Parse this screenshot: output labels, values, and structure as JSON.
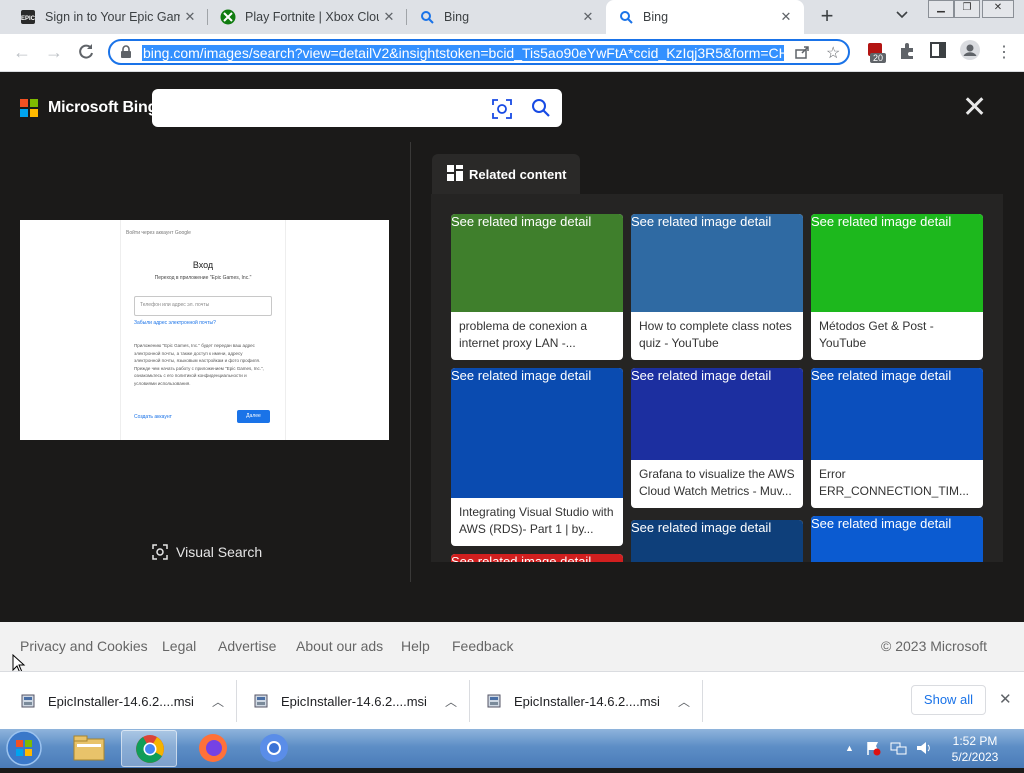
{
  "browser": {
    "tabs": [
      {
        "title": "Sign in to Your Epic Games",
        "icon": "epic-games-icon"
      },
      {
        "title": "Play Fortnite | Xbox Cloud",
        "icon": "xbox-icon"
      },
      {
        "title": "Bing",
        "icon": "search-icon"
      },
      {
        "title": "Bing",
        "icon": "search-icon",
        "active": true
      }
    ],
    "new_tab": "+",
    "url": "bing.com/images/search?view=detailV2&insightstoken=bcid_Tis5ao90eYwFtA*ccid_KzIqj3R5&form=CH",
    "extension_badge": "20"
  },
  "bing": {
    "logo": "Microsoft Bing",
    "search_value": "",
    "visual_search_label": "Visual Search",
    "related_content_label": "Related content",
    "preview": {
      "top_line": "Войти через аккаунт Google",
      "heading": "Вход",
      "subheading": "Переход в приложение \"Epic Games, Inc.\"",
      "input_placeholder": "Телефон или адрес эл. почты",
      "forgot": "Забыли адрес электронной почты?",
      "body": "Приложению \"Epic Games, Inc.\" будет передан ваш адрес электронной почты, а также доступ к имени, адресу электронной почты, языковым настройкам и фото профиля. Прежде чем начать работу с приложением \"Epic Games, Inc.\", ознакомьтесь с его политикой конфиденциальности и условиями использования.",
      "create": "Создать аккаунт",
      "next": "Далее"
    },
    "cards": [
      {
        "alt": "See related image detail",
        "caption": "problema de conexion a internet proxy LAN -...",
        "color": "#3f7f2c"
      },
      {
        "alt": "See related image detail",
        "caption": "How to complete class notes quiz - YouTube",
        "color": "#2f6aa3"
      },
      {
        "alt": "See related image detail",
        "caption": "Métodos Get & Post - YouTube",
        "color": "#1db81d"
      },
      {
        "alt": "See related image detail",
        "caption": "Integrating Visual Studio with AWS (RDS)- Part 1 | by...",
        "color": "#0a4bb0"
      },
      {
        "alt": "See related image detail",
        "caption": "Grafana to visualize the AWS Cloud Watch Metrics - Muv...",
        "color": "#1c2fa0"
      },
      {
        "alt": "See related image detail",
        "caption": "Error ERR_CONNECTION_TIM...",
        "color": "#0b4fbd"
      },
      {
        "alt": "See related image detail",
        "caption": "",
        "color": "#d11f1f"
      },
      {
        "alt": "See related image detail",
        "caption": "",
        "color": "#0e3f7a"
      },
      {
        "alt": "See related image detail",
        "caption": "",
        "color": "#0b5bd1"
      }
    ]
  },
  "footer": {
    "links": [
      "Privacy and Cookies",
      "Legal",
      "Advertise",
      "About our ads",
      "Help",
      "Feedback"
    ],
    "copyright": "© 2023 Microsoft"
  },
  "downloads": {
    "items": [
      "EpicInstaller-14.6.2....msi",
      "EpicInstaller-14.6.2....msi",
      "EpicInstaller-14.6.2....msi"
    ],
    "show_all": "Show all"
  },
  "taskbar": {
    "time": "1:52 PM",
    "date": "5/2/2023"
  }
}
